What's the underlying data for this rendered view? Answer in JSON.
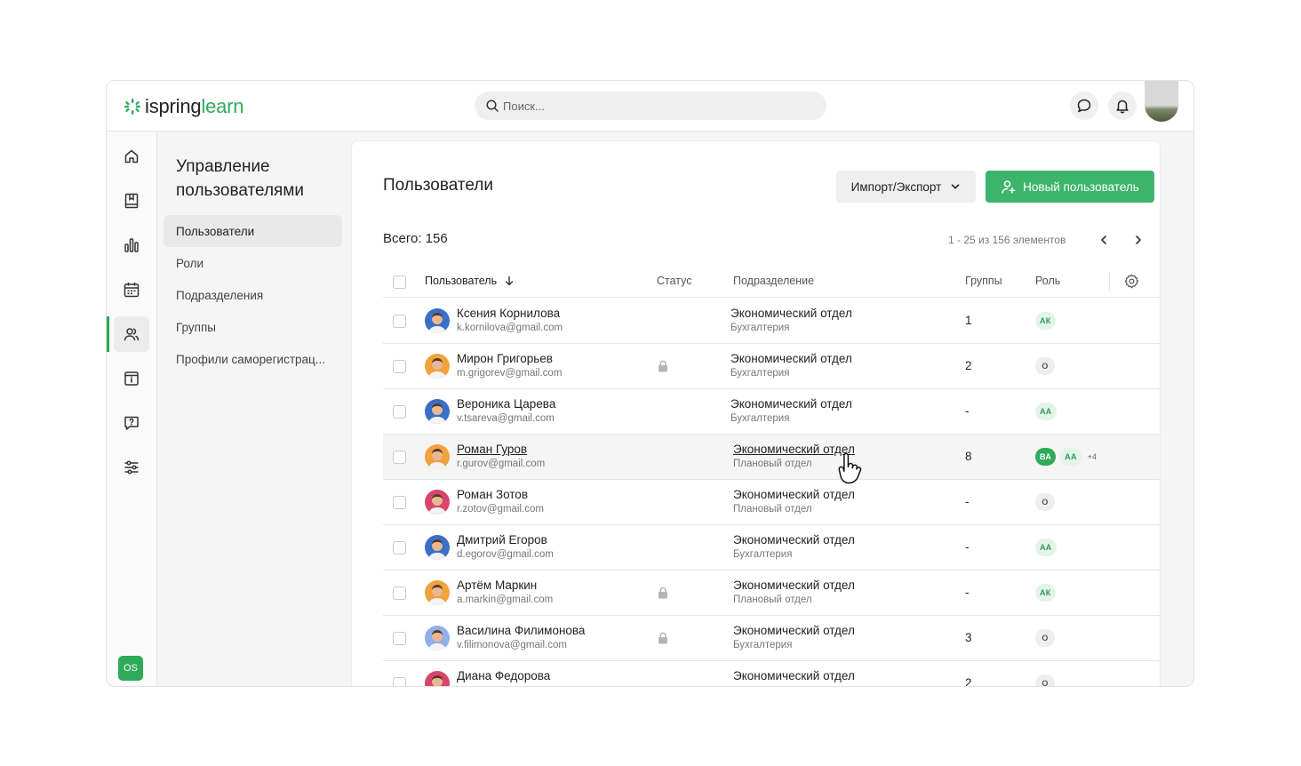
{
  "app": {
    "logo_part1": "ispring",
    "logo_part2": "learn",
    "brand_color": "#2eaa5a"
  },
  "search": {
    "placeholder": "Поиск..."
  },
  "rail": {
    "icons": [
      "home-icon",
      "book-icon",
      "chart-icon",
      "calendar-icon",
      "users-icon",
      "info-icon",
      "help-icon",
      "settings-sliders-icon"
    ],
    "active_index": 4,
    "user_initials": "OS"
  },
  "subnav": {
    "title": "Управление пользователями",
    "items": [
      {
        "label": "Пользователи",
        "active": true
      },
      {
        "label": "Роли",
        "active": false
      },
      {
        "label": "Подразделения",
        "active": false
      },
      {
        "label": "Группы",
        "active": false
      },
      {
        "label": "Профили саморегистрац...",
        "active": false
      }
    ]
  },
  "main": {
    "title": "Пользователи",
    "import_export_label": "Импорт/Экспорт",
    "new_user_label": "Новый пользователь",
    "total_label": "Всего: 156",
    "pager_text": "1 - 25 из 156 элементов"
  },
  "table": {
    "columns": {
      "user": "Пользователь",
      "status": "Статус",
      "department": "Подразделение",
      "groups": "Группы",
      "role": "Роль"
    },
    "rows": [
      {
        "name": "Ксения Корнилова",
        "email": "k.kornilova@gmail.com",
        "locked": false,
        "dept": "Экономический отдел",
        "subdept": "Бухгалтерия",
        "groups": "1",
        "roles": [
          {
            "t": "АК",
            "s": "green-light"
          }
        ],
        "more": "",
        "avatar_color": "#3a6fc7"
      },
      {
        "name": "Мирон Григорьев",
        "email": "m.grigorev@gmail.com",
        "locked": true,
        "dept": "Экономический отдел",
        "subdept": "Бухгалтерия",
        "groups": "2",
        "roles": [
          {
            "t": "О",
            "s": "gray"
          }
        ],
        "more": "",
        "avatar_color": "#f0a33c"
      },
      {
        "name": "Вероника Царева",
        "email": "v.tsareva@gmail.com",
        "locked": false,
        "dept": "Экономический отдел",
        "subdept": "Бухгалтерия",
        "groups": "-",
        "roles": [
          {
            "t": "АА",
            "s": "green-light"
          }
        ],
        "more": "",
        "avatar_color": "#3a6fc7"
      },
      {
        "name": "Роман Гуров",
        "email": "r.gurov@gmail.com",
        "locked": false,
        "dept": "Экономический отдел",
        "subdept": "Плановый отдел",
        "groups": "8",
        "roles": [
          {
            "t": "ВА",
            "s": "green"
          },
          {
            "t": "АА",
            "s": "green-light"
          }
        ],
        "more": "+4",
        "avatar_color": "#f0a33c"
      },
      {
        "name": "Роман Зотов",
        "email": "r.zotov@gmail.com",
        "locked": false,
        "dept": "Экономический отдел",
        "subdept": "Плановый отдел",
        "groups": "-",
        "roles": [
          {
            "t": "О",
            "s": "gray"
          }
        ],
        "more": "",
        "avatar_color": "#d9456a"
      },
      {
        "name": "Дмитрий Егоров",
        "email": "d.egorov@gmail.com",
        "locked": false,
        "dept": "Экономический отдел",
        "subdept": "Бухгалтерия",
        "groups": "-",
        "roles": [
          {
            "t": "АА",
            "s": "green-light"
          }
        ],
        "more": "",
        "avatar_color": "#3a6fc7"
      },
      {
        "name": "Артём Маркин",
        "email": "a.markin@gmail.com",
        "locked": true,
        "dept": "Экономический отдел",
        "subdept": "Плановый отдел",
        "groups": "-",
        "roles": [
          {
            "t": "АК",
            "s": "green-light"
          }
        ],
        "more": "",
        "avatar_color": "#f0a33c"
      },
      {
        "name": "Василина Филимонова",
        "email": "v.filimonova@gmail.com",
        "locked": true,
        "dept": "Экономический отдел",
        "subdept": "Бухгалтерия",
        "groups": "3",
        "roles": [
          {
            "t": "О",
            "s": "gray"
          }
        ],
        "more": "",
        "avatar_color": "#8fb0e8"
      },
      {
        "name": "Диана Федорова",
        "email": "",
        "locked": false,
        "dept": "Экономический отдел",
        "subdept": "",
        "groups": "2",
        "roles": [
          {
            "t": "О",
            "s": "gray"
          }
        ],
        "more": "",
        "avatar_color": "#d9456a"
      }
    ]
  }
}
